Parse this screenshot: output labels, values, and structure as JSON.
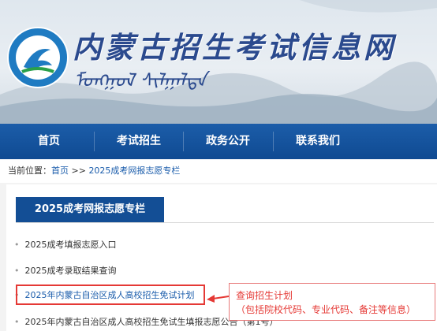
{
  "site": {
    "title": "内蒙古招生考试信息网",
    "script_line": "ᠮᠣᠩᠭᠣᠯ ᠰᠢᠯᠭᠠᠯᠲᠠ"
  },
  "nav": {
    "items": [
      {
        "label": "首页"
      },
      {
        "label": "考试招生"
      },
      {
        "label": "政务公开"
      },
      {
        "label": "联系我们"
      }
    ]
  },
  "breadcrumb": {
    "prefix": "当前位置：",
    "home": "首页",
    "sep": " >> ",
    "current": "2025成考网报志愿专栏"
  },
  "column": {
    "title": "2025成考网报志愿专栏"
  },
  "list": {
    "items": [
      {
        "label": "2025成考填报志愿入口"
      },
      {
        "label": "2025成考录取结果查询"
      },
      {
        "label": "2025年内蒙古自治区成人高校招生免试计划"
      },
      {
        "label": "2025年内蒙古自治区成人高校招生免试生填报志愿公告（第1号）"
      }
    ],
    "bullet": "•"
  },
  "annotation": {
    "line1": "查询招生计划",
    "line2": "（包括院校代码、专业代码、备注等信息）"
  },
  "colors": {
    "nav_bg": "#134e95",
    "link": "#1a5cab",
    "highlight": "#e53935"
  }
}
